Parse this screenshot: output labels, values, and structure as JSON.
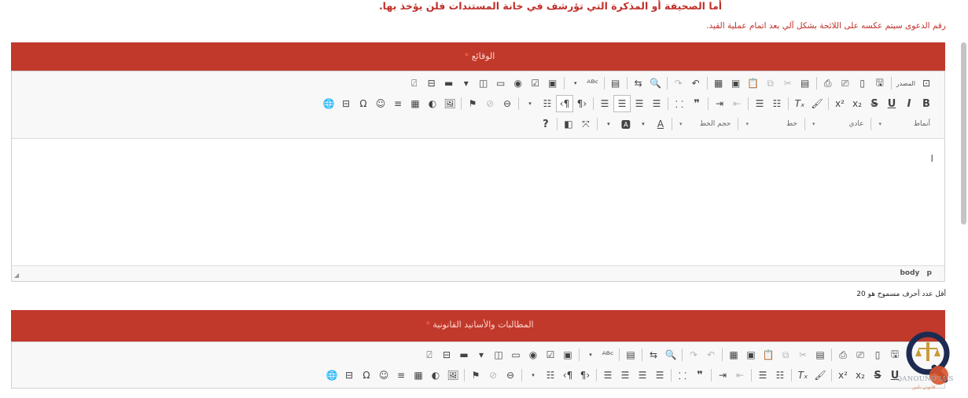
{
  "notice": {
    "top": "أما الصحيفة أو المذكرة التي تؤرشف في خانة المستندات فلن يؤخذ بها.",
    "case_number": "رقم الدعوى سيتم عكسه على اللائحة بشكل آلي بعد اتمام عملية القيد."
  },
  "panels": [
    {
      "title": "الوقائع",
      "required": "*"
    },
    {
      "title": "المطالبات والأسانيد القانونية",
      "required": "*"
    }
  ],
  "editor": {
    "source_label": "المصدر",
    "combos": {
      "styles": "أنماط",
      "format": "عادي",
      "font": "خط",
      "size": "حجم الخط"
    },
    "path": "body p",
    "help": "?"
  },
  "validation": {
    "min_chars": "أقل عدد أحرف مسموح هو 20"
  },
  "logo": {
    "text": "QANOUNIPLUS",
    "sub": "قانوني بلس"
  }
}
